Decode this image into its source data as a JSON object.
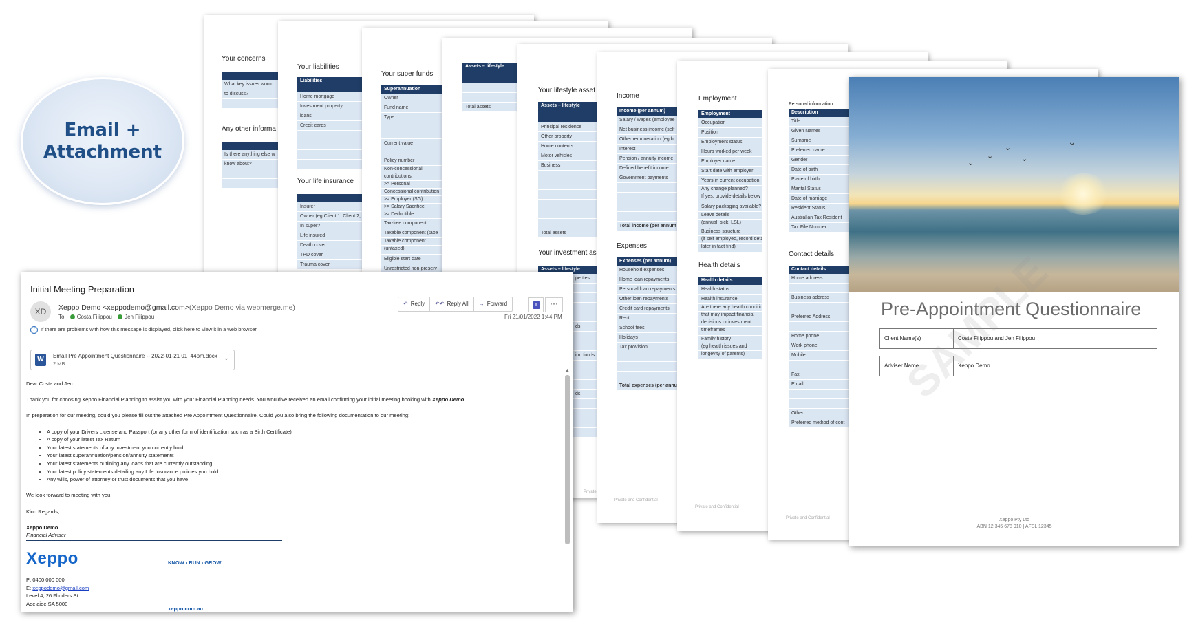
{
  "badge": {
    "line1": "Email +",
    "line2": "Attachment"
  },
  "pages": {
    "p1": {
      "sections": [
        "Your concerns",
        "Any other informa"
      ],
      "rows1": [
        "What key issues would",
        "to discuss?"
      ],
      "rows2": [
        "Is there anything else w",
        "know about?"
      ]
    },
    "p2": {
      "section1": "Your liabilities",
      "header1": "Liabilities",
      "rows1": [
        "Home mortgage",
        "Investment property",
        "loans",
        "Credit cards"
      ],
      "section2": "Your life insurance",
      "rows2": [
        "Insurer",
        "Owner (eg Client 1, Client 2, Joint)",
        "In super?",
        "Life insured",
        "Death cover",
        "TPD cover",
        "Trauma cover"
      ]
    },
    "p3": {
      "section": "Your super funds",
      "header": "Superannuation",
      "rows": [
        "Owner",
        "Fund name",
        "Type",
        "Current value",
        "Policy number",
        "Non-concessional",
        "contributions:",
        ">> Personal",
        "Concessional contribution",
        ">> Employer (SG)",
        ">> Salary Sacrifice",
        ">> Deductible",
        "Tax-free component",
        "Taxable component (taxe",
        "Taxable component",
        "(untaxed)",
        "Eligible start date",
        "Unrestricted non-preserv"
      ]
    },
    "p4": {
      "header": "Assets – lifestyle",
      "total": "Total assets"
    },
    "p5": {
      "section1": "Your lifestyle asset",
      "header1": "Assets – lifestyle",
      "rows1": [
        "Principal residence",
        "Other property",
        "Home contents",
        "Motor vehicles",
        "Business"
      ],
      "total": "Total assets",
      "section2": "Your investment as",
      "header2": "Assets – lifestyle",
      "rows2": [
        "perties",
        "ds",
        "ion funds",
        "ds"
      ],
      "footer": "Private and Confidential"
    },
    "p6": {
      "section1": "Income",
      "header1": "Income (per annum)",
      "rows1": [
        "Salary / wages (employee",
        "Net business income (self",
        "Other remuneration (eg b",
        "Interest",
        "Pension / annuity income",
        "Defined benefit income",
        "Government payments"
      ],
      "total1": "Total income (per annum",
      "section2": "Expenses",
      "header2": "Expenses (per annum)",
      "rows2": [
        "Household expenses",
        "Home loan repayments",
        "Personal loan repayments",
        "Other loan repayments",
        "Credit card repayments",
        "Rent",
        "School fees",
        "Holidays",
        "Tax provision"
      ],
      "total2": "Total expenses (per annu",
      "footer": "Private and Confidential"
    },
    "p7": {
      "section1": "Employment",
      "header1": "Employment",
      "rows1": [
        "Occupation",
        "Position",
        "Employment status",
        "Hours worked per week",
        "Employer name",
        "Start date with employer",
        "Years in current occupation",
        "Any change planned?",
        "If yes, provide details below",
        "Salary packaging available?",
        "Leave details",
        "(annual, sick, LSL)",
        "Business structure",
        "(if self employed, record deta",
        "later in fact find)"
      ],
      "section2": "Health details",
      "header2": "Health details",
      "rows2": [
        "Health status",
        "Health insurance",
        "Are there any health conditio",
        "that may impact financial",
        "decisions or investment",
        "timeframes",
        "Family history",
        "(eg health issues and",
        "longevity of parents)"
      ],
      "footer": "Private and Confidential"
    },
    "p8": {
      "section1": "Personal information",
      "header1": "Description",
      "rows1": [
        "Title",
        "Given Names",
        "Surname",
        "Preferred name",
        "Gender",
        "Date of birth",
        "Place of birth",
        "Marital Status",
        "Date of marriage",
        "Resident Status",
        "Australian Tax Resident",
        "Tax File Number"
      ],
      "section2": "Contact details",
      "header2": "Contact details",
      "rows2": [
        "Home address",
        "",
        "Business address",
        "",
        "Preferred Address",
        "",
        "Home phone",
        "Work phone",
        "Mobile",
        "",
        "Fax",
        "Email",
        "",
        "",
        "Other",
        "Preferred method of cont"
      ],
      "footer": "Private and Confidential"
    },
    "cover": {
      "title": "Pre-Appointment Questionnaire",
      "client_label": "Client Name(s)",
      "client_value": "Costa Filippou and Jen Filippou",
      "adviser_label": "Adviser Name",
      "adviser_value": "Xeppo Demo",
      "watermark": "SAMPLE",
      "footer1": "Xeppo Pty Ltd",
      "footer2": "ABN 12 345 678 910 | AFSL 12345"
    }
  },
  "email": {
    "subject": "Initial Meeting Preparation",
    "avatar": "XD",
    "from_name": "Xeppo Demo <xeppodemo@gmail.com>",
    "from_via": "(Xeppo Demo via webmerge.me)",
    "to_label": "To",
    "to1": "Costa Filippou",
    "to2": "Jen Filippou",
    "info": "If there are problems with how this message is displayed, click here to view it in a web browser.",
    "buttons": {
      "reply": "Reply",
      "reply_all": "Reply All",
      "forward": "Forward"
    },
    "date": "Fri 21/01/2022 1:44 PM",
    "attachment": {
      "name": "Email Pre Appointment Questionnaire -- 2022-01-21 01_44pm.docx",
      "size": "2 MB"
    },
    "greeting": "Dear Costa and Jen",
    "para1_pre": "Thank you for choosing Xeppo Financial Planning to assist you with your Financial Planning needs. You would've received an email confirming your initial meeting booking with ",
    "para1_bold": "Xeppo Demo",
    "para1_post": ".",
    "para2": "In preperation for our meeting, could you please fill out the attached Pre Appointment Questionnaire. Could you also bring the following documentation to our meeting:",
    "bullets": [
      "A copy of your Drivers License and Passport (or any other form of identification such as a Birth Certificate)",
      "A copy of your latest Tax Return",
      "Your latest statements of any investment you currently hold",
      "Your latest superannuation/pension/annuity statements",
      "Your latest statements outlining any loans that are currently outstanding",
      "Your latest policy statements detailing any Life Insurance policies you hold",
      "Any wills, power of attorney or trust documents that you have"
    ],
    "closing": "We look forward to meeting with you.",
    "regards": "Kind Regards,",
    "sig_name": "Xeppo Demo",
    "sig_role": "Financial Adviser",
    "logo": "Xeppo",
    "tagline": "KNOW › RUN › GROW",
    "phone": "P: 0400 000 000",
    "email_label": "E: ",
    "email_link": "xeppodemo@gmail.com",
    "addr1": "Level 4, 26 Flinders St",
    "addr2": "Adelaide SA 5000",
    "website": "xeppo.com.au"
  }
}
